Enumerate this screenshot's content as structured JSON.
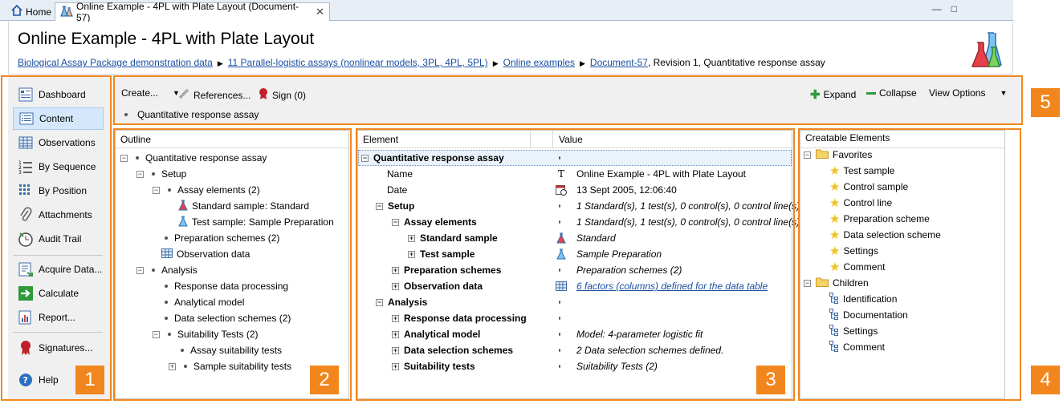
{
  "tabs": {
    "home": "Home",
    "active": "Online Example - 4PL with Plate Layout (Document-57)"
  },
  "header": {
    "title": "Online Example - 4PL with Plate Layout",
    "breadcrumbs": [
      "Biological Assay Package demonstration data",
      "11 Parallel-logistic assays (nonlinear models, 3PL, 4PL, 5PL)",
      "Online examples",
      "Document-57"
    ],
    "revision_text": ", Revision 1, Quantitative response assay"
  },
  "nav": {
    "items": [
      "Dashboard",
      "Content",
      "Observations",
      "By Sequence",
      "By Position",
      "Attachments",
      "Audit Trail",
      "Acquire Data...",
      "Calculate",
      "Report...",
      "Signatures...",
      "Help"
    ],
    "selected": "Content"
  },
  "toolbar": {
    "create": "Create...",
    "references": "References...",
    "sign": "Sign (0)",
    "expand": "Expand",
    "collapse": "Collapse",
    "view_options": "View Options",
    "breadcrumb": "Quantitative response assay"
  },
  "outline": {
    "header": "Outline",
    "rows": [
      "Quantitative response assay",
      "Setup",
      "Assay elements (2)",
      "Standard sample: Standard",
      "Test sample: Sample Preparation",
      "Preparation schemes (2)",
      "Observation data",
      "Analysis",
      "Response data processing",
      "Analytical model",
      "Data selection schemes (2)",
      "Suitability Tests (2)",
      "Assay suitability tests",
      "Sample suitability tests"
    ]
  },
  "element_table": {
    "col_element": "Element",
    "col_value": "Value",
    "rows": [
      {
        "name": "Quantitative response assay",
        "value": ""
      },
      {
        "name": "Name",
        "value": "Online Example - 4PL with Plate Layout"
      },
      {
        "name": "Date",
        "value": "13 Sept 2005, 12:06:40"
      },
      {
        "name": "Setup",
        "value": "1 Standard(s), 1 test(s), 0 control(s), 0 control line(s)"
      },
      {
        "name": "Assay elements",
        "value": "1 Standard(s), 1 test(s), 0 control(s), 0 control line(s)"
      },
      {
        "name": "Standard sample",
        "value": "Standard"
      },
      {
        "name": "Test sample",
        "value": "Sample Preparation"
      },
      {
        "name": "Preparation schemes",
        "value": "Preparation schemes (2)"
      },
      {
        "name": "Observation data",
        "value": "6 factors (columns) defined for the data table"
      },
      {
        "name": "Analysis",
        "value": ""
      },
      {
        "name": "Response data processing",
        "value": ""
      },
      {
        "name": "Analytical model",
        "value": "Model: 4-parameter logistic fit"
      },
      {
        "name": "Data selection schemes",
        "value": "2 Data selection schemes defined."
      },
      {
        "name": "Suitability tests",
        "value": "Suitability Tests (2)"
      }
    ]
  },
  "creatable": {
    "header": "Creatable Elements",
    "favorites": "Favorites",
    "favorite_items": [
      "Test sample",
      "Control sample",
      "Control line",
      "Preparation scheme",
      "Data selection scheme",
      "Settings",
      "Comment"
    ],
    "children": "Children",
    "children_items": [
      "Identification",
      "Documentation",
      "Settings",
      "Comment"
    ]
  },
  "badges": [
    "1",
    "2",
    "3",
    "4",
    "5"
  ],
  "colors": {
    "accent_orange": "#f2861e",
    "selection": "#d5e8fb",
    "link": "#1a4fa0"
  }
}
